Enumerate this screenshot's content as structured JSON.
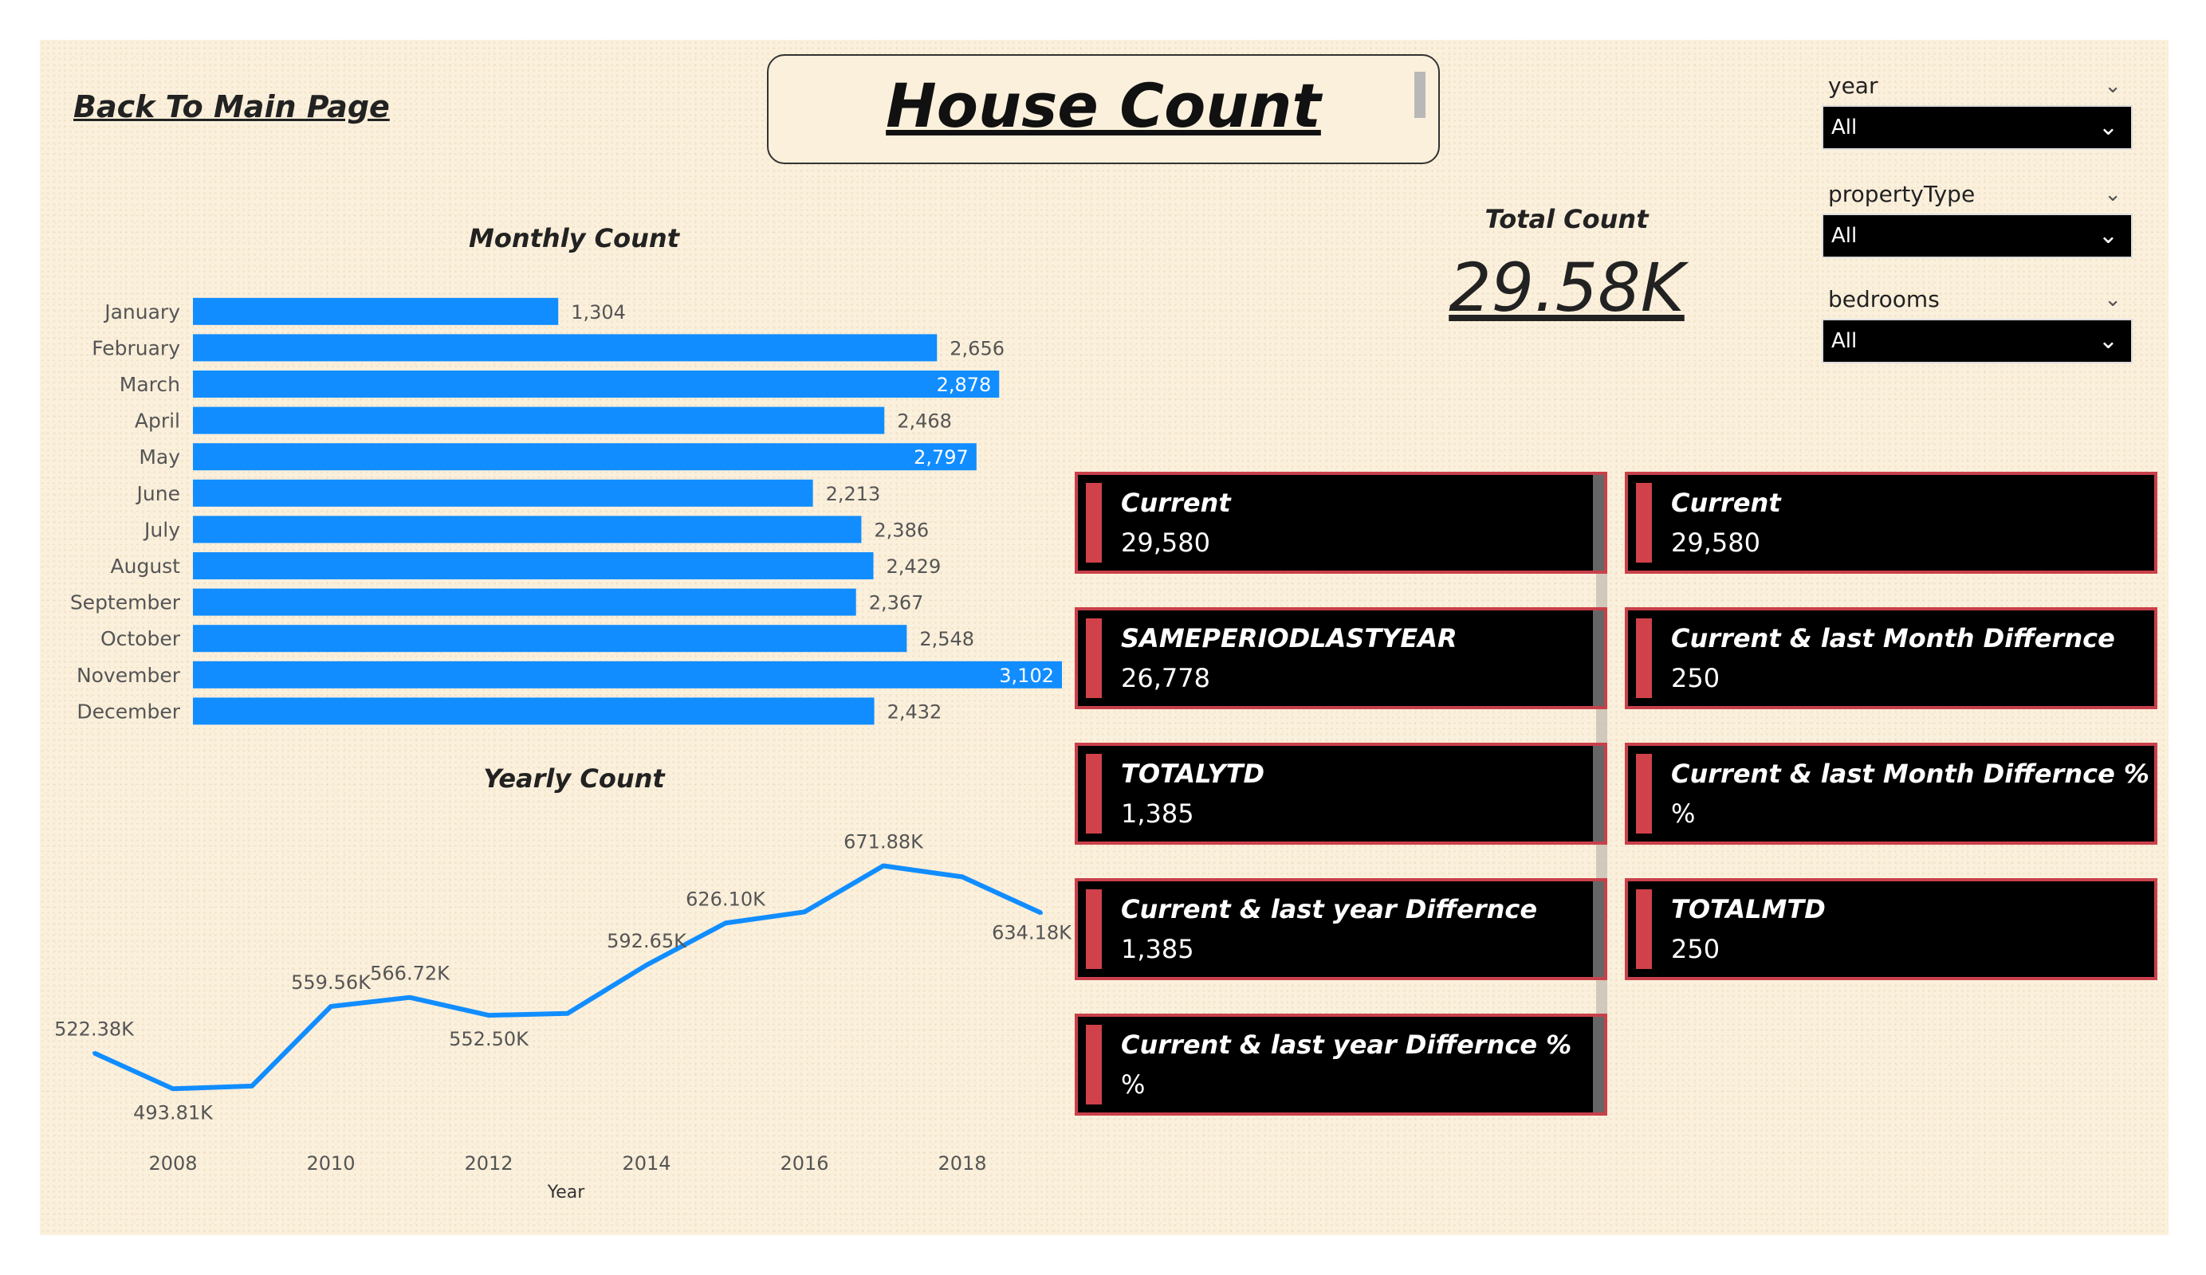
{
  "nav": {
    "back_label": "Back To Main Page"
  },
  "header": {
    "title": "House Count "
  },
  "total": {
    "label": "Total Count",
    "value": "29.58K"
  },
  "slicers": [
    {
      "name": "year",
      "value": "All"
    },
    {
      "name": "propertyType",
      "value": "All"
    },
    {
      "name": "bedrooms",
      "value": "All"
    }
  ],
  "cards": {
    "left": [
      {
        "label": "Current",
        "value": "29,580"
      },
      {
        "label": "SAMEPERIODLASTYEAR",
        "value": "26,778"
      },
      {
        "label": "TOTALYTD",
        "value": "1,385"
      },
      {
        "label": "Current & last year Differnce",
        "value": "1,385"
      },
      {
        "label": "Current & last year Differnce %",
        "value": "%"
      }
    ],
    "right": [
      {
        "label": "Current",
        "value": "29,580"
      },
      {
        "label": "Current & last Month Differnce",
        "value": "250"
      },
      {
        "label": "Current & last Month Differnce %",
        "value": "%"
      },
      {
        "label": "TOTALMTD",
        "value": "250"
      }
    ]
  },
  "colors": {
    "bar": "#118dff",
    "card_accent": "#d0414a",
    "background": "#fbf0dc"
  },
  "chart_data": [
    {
      "type": "bar",
      "orientation": "horizontal",
      "title": "Monthly Count",
      "categories": [
        "January",
        "February",
        "March",
        "April",
        "May",
        "June",
        "July",
        "August",
        "September",
        "October",
        "November",
        "December"
      ],
      "values": [
        1304,
        2656,
        2878,
        2468,
        2797,
        2213,
        2386,
        2429,
        2367,
        2548,
        3102,
        2432
      ],
      "value_labels": [
        "1,304",
        "2,656",
        "2,878",
        "2,468",
        "2,797",
        "2,213",
        "2,386",
        "2,429",
        "2,367",
        "2,548",
        "3,102",
        "2,432"
      ],
      "xlim": [
        0,
        3102
      ]
    },
    {
      "type": "line",
      "title": "Yearly Count",
      "xlabel": "Year",
      "x": [
        2007,
        2008,
        2009,
        2010,
        2011,
        2012,
        2013,
        2014,
        2015,
        2016,
        2017,
        2018,
        2019
      ],
      "values": [
        522380,
        493810,
        496000,
        559560,
        566720,
        552500,
        554000,
        592650,
        626100,
        635000,
        671880,
        663000,
        634180
      ],
      "labels": [
        "522.38K",
        "493.81K",
        "",
        "559.56K",
        "566.72K",
        "552.50K",
        "",
        "592.65K",
        "626.10K",
        "",
        "671.88K",
        "",
        "634.18K"
      ],
      "xticks": [
        "2008",
        "2010",
        "2012",
        "2014",
        "2016",
        "2018"
      ],
      "ylim": [
        480000,
        690000
      ]
    }
  ]
}
